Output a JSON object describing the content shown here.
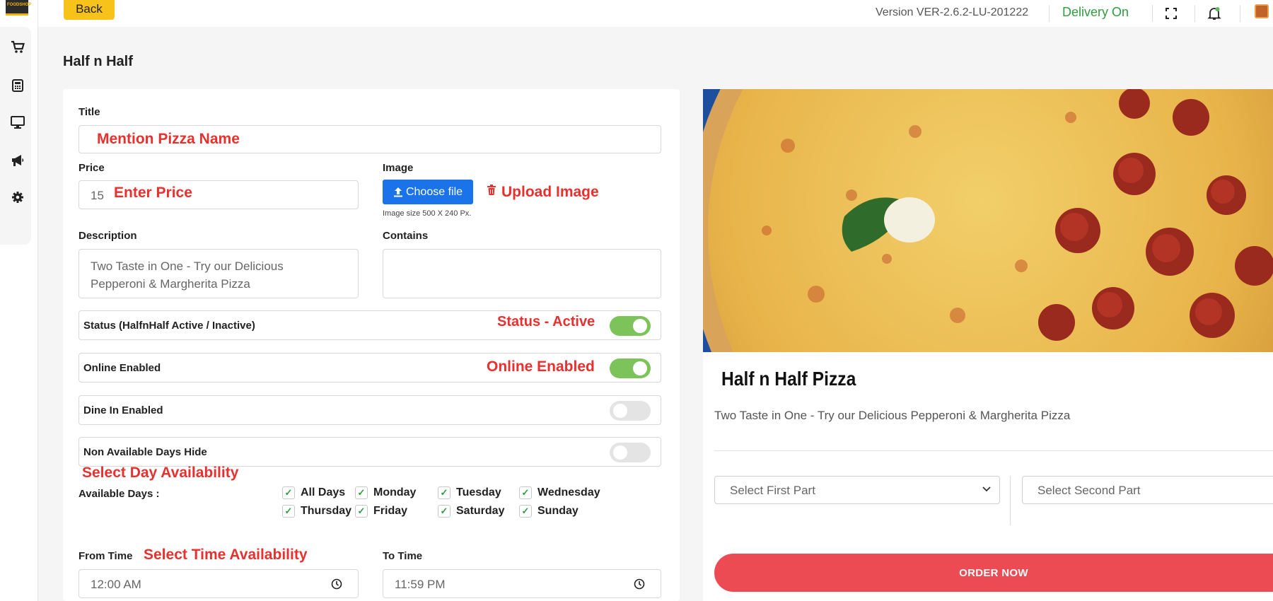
{
  "app": {
    "logo_text": "FOODSHOP"
  },
  "sidebar": {
    "items": [
      {
        "name": "cart-icon"
      },
      {
        "name": "calculator-icon"
      },
      {
        "name": "monitor-icon"
      },
      {
        "name": "megaphone-icon"
      },
      {
        "name": "gear-icon"
      }
    ]
  },
  "topbar": {
    "back_label": "Back",
    "version": "Version VER-2.6.2-LU-201222",
    "delivery_status": "Delivery On",
    "delivery_color": "#2e9e3e",
    "icons": [
      "fullscreen-icon",
      "bell-icon",
      "avatar"
    ]
  },
  "page": {
    "title": "Half n Half"
  },
  "form": {
    "title_label": "Title",
    "title_annotation": "Mention Pizza Name",
    "price_label": "Price",
    "price_value": "15",
    "price_annotation": "Enter Price",
    "image_label": "Image",
    "choose_file_label": "Choose file",
    "image_annotation": "Upload Image",
    "image_size_note": "Image size 500 X 240 Px.",
    "description_label": "Description",
    "description_value": "Two Taste in One - Try our Delicious Pepperoni & Margherita  Pizza",
    "contains_label": "Contains",
    "contains_value": "",
    "status_label": "Status (HalfnHalf Active / Inactive)",
    "status_annotation": "Status - Active",
    "status_on": true,
    "online_label": "Online Enabled",
    "online_annotation": "Online Enabled",
    "online_on": true,
    "dinein_label": "Dine In Enabled",
    "dinein_on": false,
    "nonavail_label": "Non Available Days Hide",
    "nonavail_on": false,
    "days_annotation": "Select Day Availability",
    "available_days_label": "Available Days :",
    "days": [
      {
        "label": "All Days",
        "checked": true
      },
      {
        "label": "Monday",
        "checked": true
      },
      {
        "label": "Tuesday",
        "checked": true
      },
      {
        "label": "Wednesday",
        "checked": true
      },
      {
        "label": "Thursday",
        "checked": true
      },
      {
        "label": "Friday",
        "checked": true
      },
      {
        "label": "Saturday",
        "checked": true
      },
      {
        "label": "Sunday",
        "checked": true
      }
    ],
    "from_time_label": "From Time",
    "time_annotation": "Select Time Availability",
    "from_time_value": "12:00 AM",
    "to_time_label": "To Time",
    "to_time_value": "11:59 PM",
    "accent_color": "#e8312e"
  },
  "preview": {
    "name": "Half n Half Pizza",
    "description": "Two Taste in One - Try our Delicious Pepperoni & Margherita Pizza",
    "first_part_placeholder": "Select First Part",
    "second_part_placeholder": "Select Second Part",
    "order_label": "ORDER NOW",
    "order_color": "#ec4b54"
  }
}
